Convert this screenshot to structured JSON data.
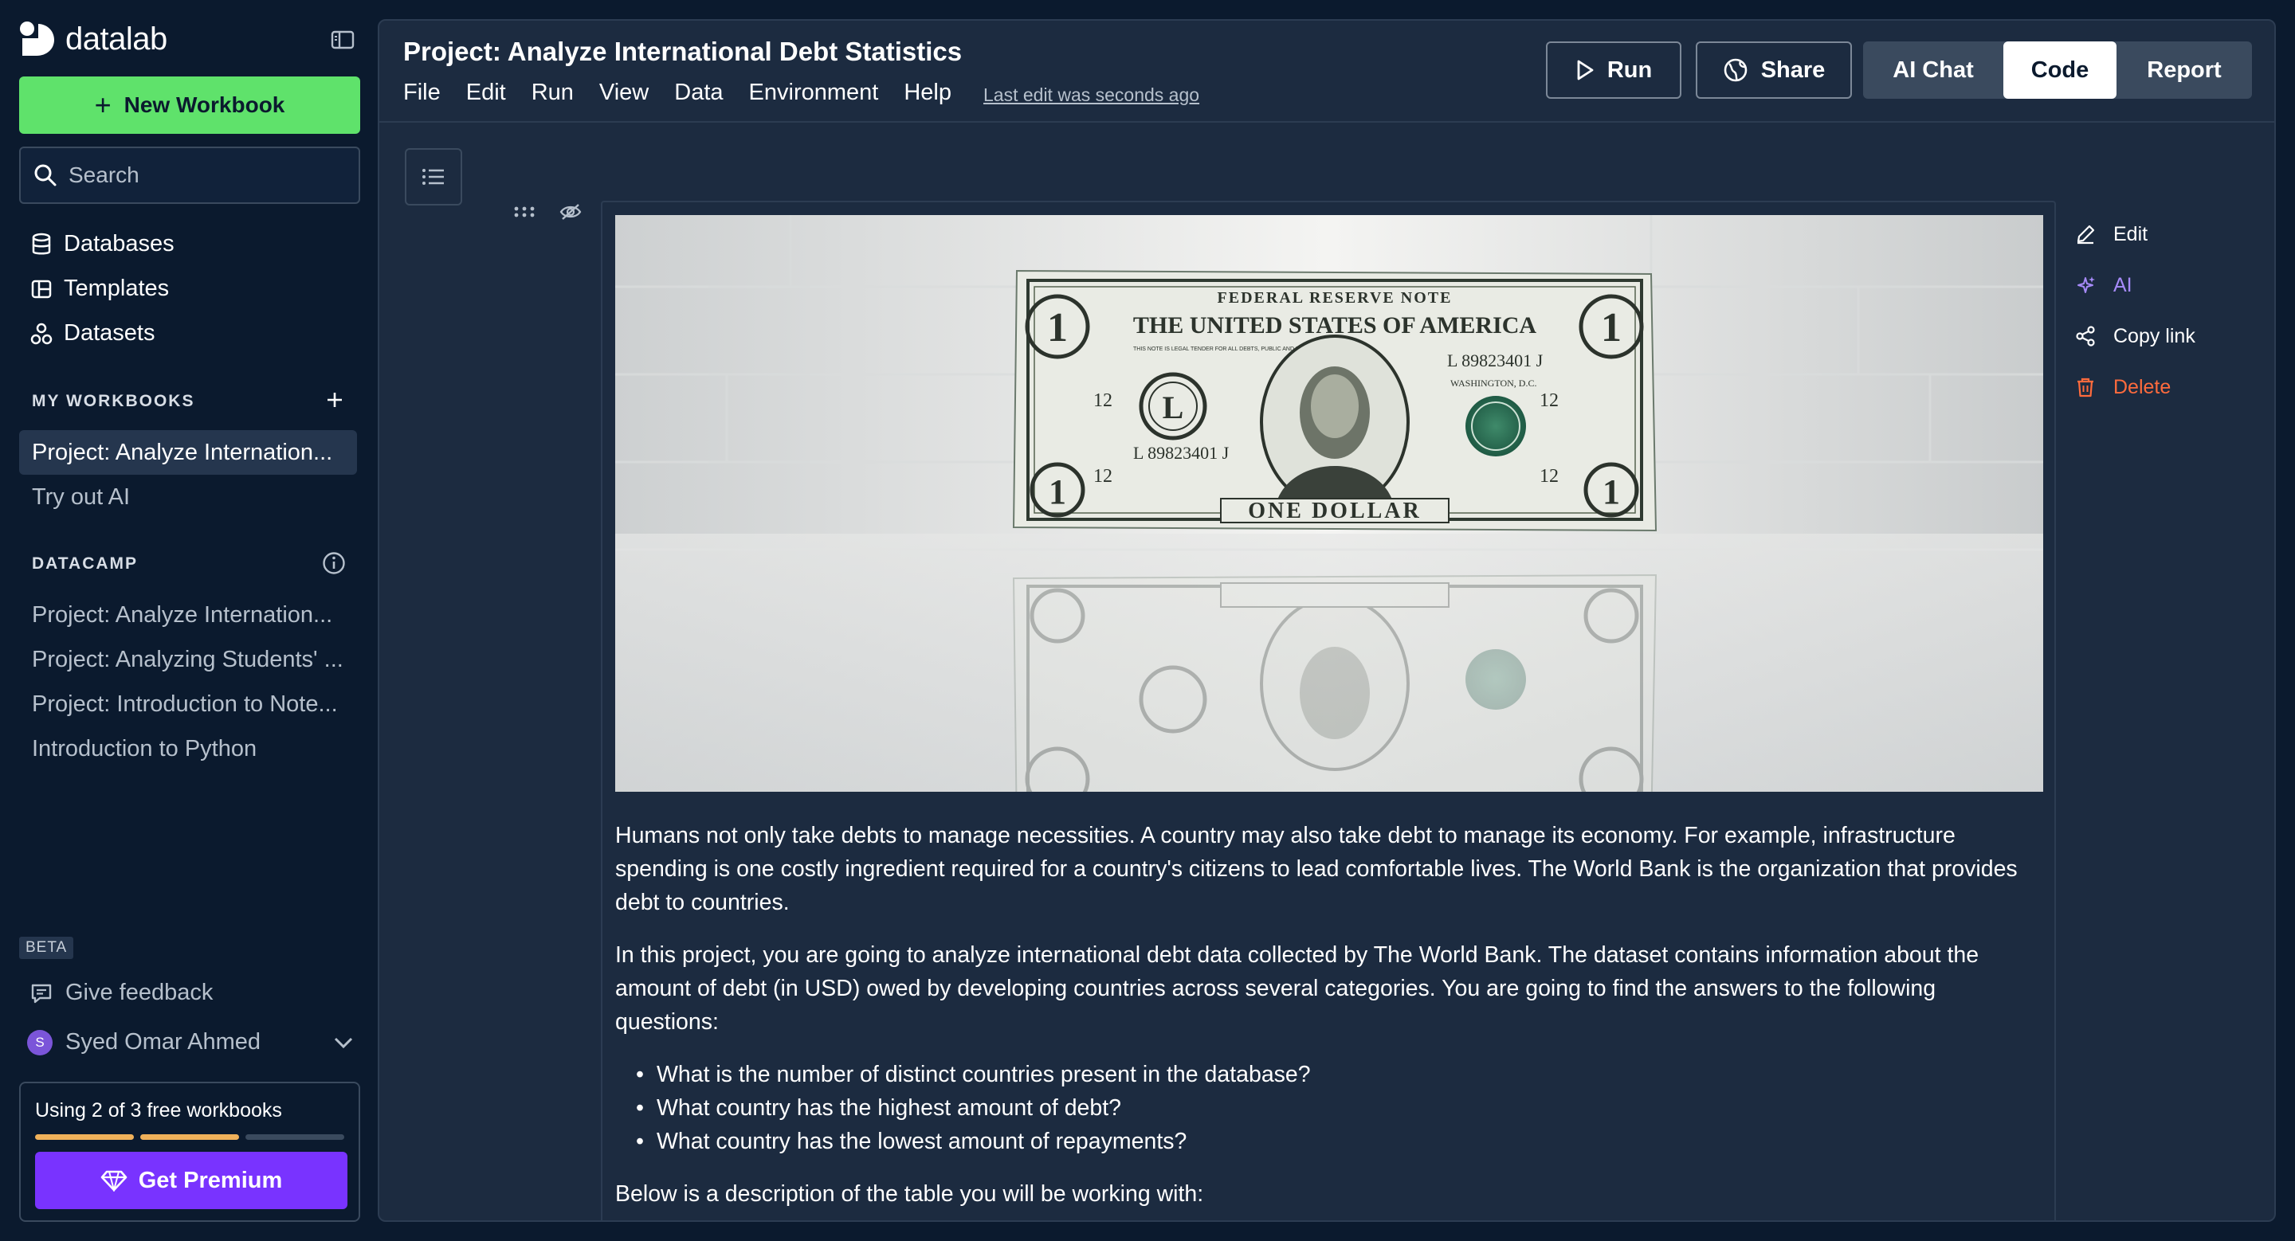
{
  "app": {
    "name": "datalab"
  },
  "sidebar": {
    "new_workbook": "New Workbook",
    "search_placeholder": "Search",
    "nav": [
      {
        "label": "Databases",
        "icon": "database-icon"
      },
      {
        "label": "Templates",
        "icon": "templates-icon"
      },
      {
        "label": "Datasets",
        "icon": "datasets-icon"
      }
    ],
    "my_workbooks_label": "MY WORKBOOKS",
    "my_workbooks": [
      {
        "label": "Project: Analyze Internation...",
        "active": true
      },
      {
        "label": "Try out AI",
        "active": false
      }
    ],
    "datacamp_label": "DATACAMP",
    "datacamp_items": [
      "Project: Analyze Internation...",
      "Project: Analyzing Students' ...",
      "Project: Introduction to Note...",
      "Introduction to Python"
    ],
    "beta": "BETA",
    "feedback": "Give feedback",
    "user": {
      "initial": "S",
      "name": "Syed Omar Ahmed"
    },
    "usage": {
      "text": "Using 2 of 3 free workbooks",
      "used": 2,
      "total": 3
    },
    "premium": "Get Premium",
    "colors": {
      "accent_green": "#5fe26b",
      "premium_purple": "#7933ff",
      "usage_orange": "#f0b15a"
    }
  },
  "topbar": {
    "title": "Project: Analyze International Debt Statistics",
    "menu": [
      "File",
      "Edit",
      "Run",
      "View",
      "Data",
      "Environment",
      "Help"
    ],
    "last_edit": "Last edit was seconds ago",
    "run": "Run",
    "share": "Share",
    "modes": [
      "AI Chat",
      "Code",
      "Report"
    ],
    "selected_mode": "Code"
  },
  "cell": {
    "image_alt": "US one dollar bill reflected on a white surface",
    "bill": {
      "top_banner": "FEDERAL RESERVE NOTE",
      "country": "THE UNITED STATES OF AMERICA",
      "serial": "L 89823401 J",
      "denomination": "ONE DOLLAR",
      "district_letter": "L",
      "number": "12",
      "value": "1",
      "legal_tender": "THIS NOTE IS LEGAL TENDER FOR ALL DEBTS, PUBLIC AND PRIVATE",
      "place": "WASHINGTON, D.C."
    },
    "paragraphs": [
      "Humans not only take debts to manage necessities. A country may also take debt to manage its economy. For example, infrastructure spending is one costly ingredient required for a country's citizens to lead comfortable lives. The World Bank is the organization that provides debt to countries.",
      "In this project, you are going to analyze international debt data collected by The World Bank. The dataset contains information about the amount of debt (in USD) owed by developing countries across several categories. You are going to find the answers to the following questions:"
    ],
    "bullets": [
      "What is the number of distinct countries present in the database?",
      "What country has the highest amount of debt?",
      "What country has the lowest amount of repayments?"
    ],
    "footer": "Below is a description of the table you will be working with:"
  },
  "cell_menu": [
    {
      "label": "Edit",
      "icon": "pencil-icon",
      "color": "#ffffff"
    },
    {
      "label": "AI",
      "icon": "sparkle-icon",
      "color": "#a78bfa"
    },
    {
      "label": "Copy link",
      "icon": "share-icon",
      "color": "#ffffff"
    },
    {
      "label": "Delete",
      "icon": "trash-icon",
      "color": "#ff6b3d"
    }
  ]
}
